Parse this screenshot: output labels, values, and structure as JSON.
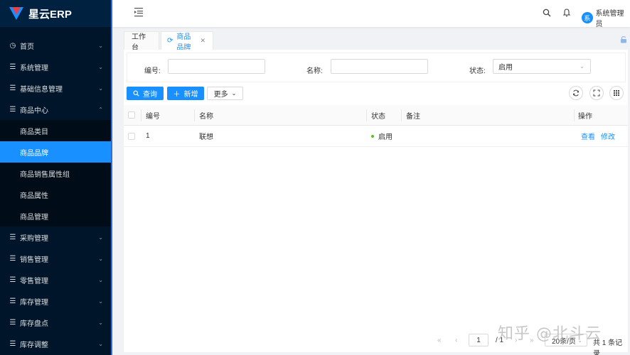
{
  "app": {
    "logo_text": "星云ERP"
  },
  "sidebar": {
    "items": [
      {
        "label": "首页",
        "icon": "dashboard-icon"
      },
      {
        "label": "系统管理",
        "icon": "menu-icon"
      },
      {
        "label": "基础信息管理",
        "icon": "menu-icon"
      },
      {
        "label": "商品中心",
        "icon": "menu-icon",
        "expanded": true
      },
      {
        "label": "采购管理",
        "icon": "menu-icon"
      },
      {
        "label": "销售管理",
        "icon": "menu-icon"
      },
      {
        "label": "零售管理",
        "icon": "menu-icon"
      },
      {
        "label": "库存管理",
        "icon": "menu-icon"
      },
      {
        "label": "库存盘点",
        "icon": "menu-icon"
      },
      {
        "label": "库存调整",
        "icon": "menu-icon"
      }
    ],
    "sub_items": [
      {
        "label": "商品类目"
      },
      {
        "label": "商品品牌",
        "active": true
      },
      {
        "label": "商品销售属性组"
      },
      {
        "label": "商品属性"
      },
      {
        "label": "商品管理"
      }
    ]
  },
  "header": {
    "user_avatar": "系",
    "user_name": "系统管理员"
  },
  "tabs": [
    {
      "label": "工作台"
    },
    {
      "label": "商品品牌",
      "active": true
    }
  ],
  "search_form": {
    "code_label": "编号:",
    "name_label": "名称:",
    "status_label": "状态:",
    "status_value": "启用"
  },
  "toolbar": {
    "query_label": "查询",
    "add_label": "新增",
    "more_label": "更多"
  },
  "table": {
    "columns": [
      "编号",
      "名称",
      "状态",
      "备注",
      "操作"
    ],
    "rows": [
      {
        "code": "1",
        "name": "联想",
        "status": "启用",
        "remark": "",
        "actions": [
          "查看",
          "修改"
        ]
      }
    ]
  },
  "pagination": {
    "current_page": "1",
    "total_pages": "/ 1",
    "page_size": "20条/页",
    "total": "共 1 条记录"
  },
  "watermark": "知乎 @北斗云",
  "colors": {
    "primary": "#1890ff",
    "sidebar_bg": "#001529",
    "status_enabled": "#52c41a"
  }
}
